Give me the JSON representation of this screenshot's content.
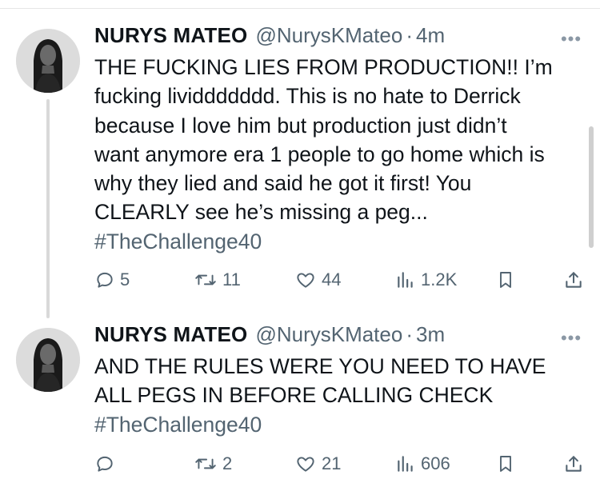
{
  "tweets": [
    {
      "name": "NURYS MATEO",
      "handle": "@NurysKMateo",
      "separator": "·",
      "time": "4m",
      "more": "•••",
      "lines": [
        "THE FUCKING LIES FROM PRODUCTION!! I’m",
        "fucking lividdddddd. This is no hate to Derrick",
        "because I love him but production just didn’t",
        "want anymore era 1 people to go home which is",
        "why they lied and said he got it first! You",
        "CLEARLY see he’s missing a peg..."
      ],
      "hashtag": "#TheChallenge40",
      "actions": {
        "reply": {
          "icon": "reply-icon",
          "count": "5"
        },
        "retweet": {
          "icon": "retweet-icon",
          "count": "11"
        },
        "like": {
          "icon": "heart-icon",
          "count": "44"
        },
        "views": {
          "icon": "views-icon",
          "count": "1.2K"
        },
        "bookmark": {
          "icon": "bookmark-icon"
        },
        "share": {
          "icon": "share-icon"
        }
      }
    },
    {
      "name": "NURYS MATEO",
      "handle": "@NurysKMateo",
      "separator": "·",
      "time": "3m",
      "more": "•••",
      "lines": [
        "AND THE RULES WERE YOU NEED TO HAVE",
        "ALL PEGS IN BEFORE CALLING CHECK"
      ],
      "hashtag": "#TheChallenge40",
      "actions": {
        "reply": {
          "icon": "reply-icon",
          "count": ""
        },
        "retweet": {
          "icon": "retweet-icon",
          "count": "2"
        },
        "like": {
          "icon": "heart-icon",
          "count": "21"
        },
        "views": {
          "icon": "views-icon",
          "count": "606"
        },
        "bookmark": {
          "icon": "bookmark-icon"
        },
        "share": {
          "icon": "share-icon"
        }
      }
    }
  ],
  "colors": {
    "text": "#0f1419",
    "secondary": "#536471",
    "divider": "#e6e6e6",
    "thread_line": "#d9d9d9"
  }
}
